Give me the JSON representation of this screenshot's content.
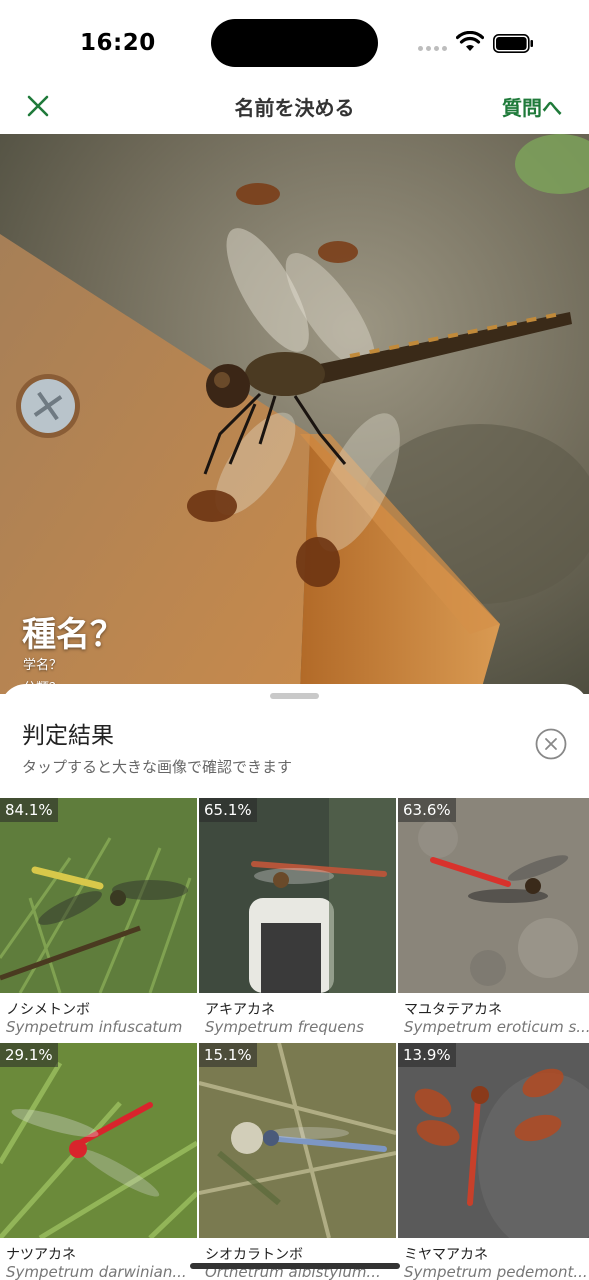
{
  "status": {
    "time": "16:20"
  },
  "nav": {
    "title": "名前を決める",
    "action": "質問へ",
    "close_icon": "close-icon",
    "accent": "#1f7a3a"
  },
  "hero": {
    "species": "種名？",
    "scientific": "学名？",
    "family": "分類？"
  },
  "sheet": {
    "title": "判定結果",
    "subtitle": "タップすると大きな画像で確認できます",
    "close_icon": "close-circle-icon"
  },
  "results": [
    {
      "pct": "84.1%",
      "name": "ノシメトンボ",
      "sci": "Sympetrum infuscatum",
      "body_color": "#d8c84a",
      "bg": "#5f7d3c"
    },
    {
      "pct": "65.1%",
      "name": "アキアカネ",
      "sci": "Sympetrum frequens",
      "body_color": "#b5553a",
      "bg": "#3f4a3e"
    },
    {
      "pct": "63.6%",
      "name": "マユタテアカネ",
      "sci": "Sympetrum eroticum s...",
      "body_color": "#d8322c",
      "bg": "#8a857a"
    },
    {
      "pct": "29.1%",
      "name": "ナツアカネ",
      "sci": "Sympetrum darwinian...",
      "body_color": "#d9242c",
      "bg": "#6b8a3a"
    },
    {
      "pct": "15.1%",
      "name": "シオカラトンボ",
      "sci": "Orthetrum albistylum...",
      "body_color": "#7d97c4",
      "bg": "#7a7a50"
    },
    {
      "pct": "13.9%",
      "name": "ミヤマアカネ",
      "sci": "Sympetrum pedemont...",
      "body_color": "#c8402a",
      "bg": "#5a5a5a"
    }
  ]
}
